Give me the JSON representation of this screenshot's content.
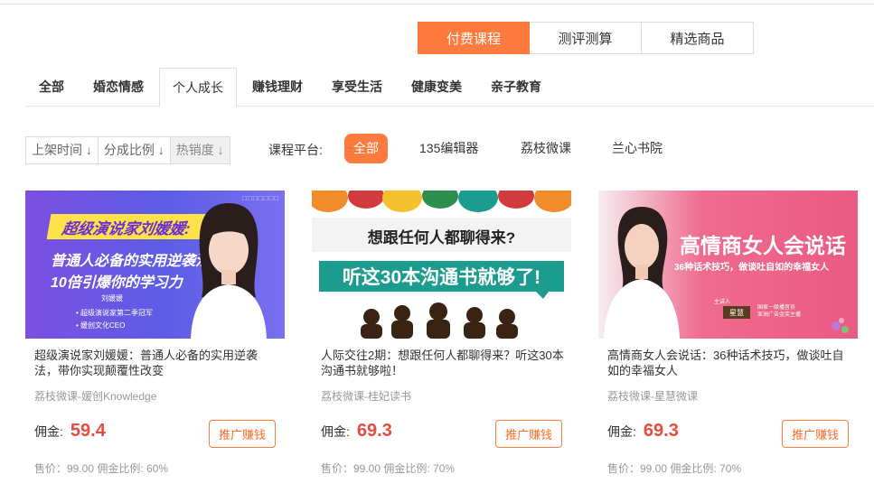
{
  "top_tabs": [
    {
      "label": "付费课程",
      "active": true
    },
    {
      "label": "测评测算",
      "active": false
    },
    {
      "label": "精选商品",
      "active": false
    }
  ],
  "categories": [
    {
      "label": "全部",
      "active": false
    },
    {
      "label": "婚恋情感",
      "active": false
    },
    {
      "label": "个人成长",
      "active": true
    },
    {
      "label": "赚钱理财",
      "active": false
    },
    {
      "label": "享受生活",
      "active": false
    },
    {
      "label": "健康变美",
      "active": false
    },
    {
      "label": "亲子教育",
      "active": false
    }
  ],
  "sorts": [
    {
      "label": "上架时间 ↓",
      "active": false
    },
    {
      "label": "分成比例 ↓",
      "active": false
    },
    {
      "label": "热销度 ↓",
      "active": true
    }
  ],
  "platform": {
    "label": "课程平台:",
    "options": [
      {
        "label": "全部",
        "active": true
      },
      {
        "label": "135编辑器",
        "active": false
      },
      {
        "label": "荔枝微课",
        "active": false
      },
      {
        "label": "兰心书院",
        "active": false
      }
    ]
  },
  "cards": [
    {
      "title": "超级演说家刘媛媛：普通人必备的实用逆袭法，带你实现颠覆性改变",
      "source": "荔枝微课-媛创Knowledge",
      "commission_label": "佣金:",
      "commission": "59.4",
      "button": "推广赚钱",
      "footer": "售价：99.00 佣金比例: 60%",
      "thumb": {
        "headline": "超级演说家刘媛媛:",
        "line1": "普通人必备的实用逆袭法,",
        "line2": "10倍引爆你的学习力",
        "name": "刘媛媛",
        "bullet1": "• 超级演说家第二季冠军",
        "bullet2": "• 媛创文化CEO",
        "corner": "□□□□□□□"
      }
    },
    {
      "title": "人际交往2期：想跟任何人都聊得来？听这30本沟通书就够啦！",
      "source": "荔枝微课-桂妃读书",
      "commission_label": "佣金:",
      "commission": "69.3",
      "button": "推广赚钱",
      "footer": "售价：99.00 佣金比例: 70%",
      "thumb": {
        "question": "想跟任何人都聊得来?",
        "banner": "听这30本沟通书就够了!"
      }
    },
    {
      "title": "高情商女人会说话：36种话术技巧，做谈吐自如的幸福女人",
      "source": "荔枝微课-星慧微课",
      "commission_label": "佣金:",
      "commission": "69.3",
      "button": "推广赚钱",
      "footer": "售价：99.00 佣金比例: 70%",
      "thumb": {
        "headline": "高情商女人会说话",
        "sub": "36种话术技巧，做谈吐自如的幸福女人",
        "speaker_label": "主讲人",
        "name": "星慧",
        "info1": "国家一级播音员",
        "info2": "亚洲广告金奖主播"
      }
    }
  ],
  "colors": {
    "accent": "#ff7a3d",
    "price": "#e74c3c",
    "teal": "#1b9c8e"
  }
}
